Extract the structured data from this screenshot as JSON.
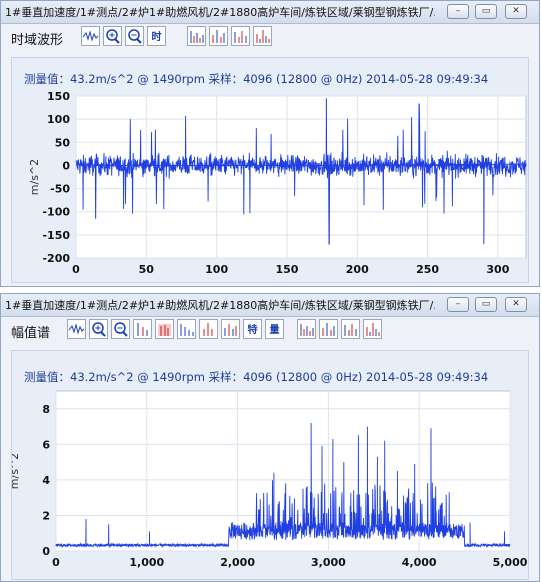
{
  "win1": {
    "title": "1#垂直加速度/1#测点/2#炉1#助燃风机/2#1880高炉车间/炼铁区域/莱钢型钢炼铁厂/…",
    "mode_label": "时域波形",
    "buttons": [
      "wave",
      "zoom-in",
      "zoom-out",
      "时",
      "spectrum",
      "peaks",
      "peaks-alt",
      "spectrum-alt"
    ],
    "time_btn_label": "时",
    "info": "测量值：43.2m/s^2 @ 1490rpm  采样：4096 (12800 @ 0Hz)  2014-05-28 09:49:34"
  },
  "win2": {
    "title": "1#垂直加速度/1#测点/2#炉1#助燃风机/2#1880高炉车间/炼铁区域/莱钢型钢炼铁厂/…",
    "mode_label": "幅值谱",
    "buttons": [
      "wave",
      "zoom-in",
      "zoom-out",
      "cursor",
      "band",
      "harmonic",
      "sideband",
      "marker",
      "特",
      "量",
      "spectrum",
      "peaks",
      "peaks-alt",
      "spectrum-alt"
    ],
    "feature_btn_label": "特",
    "amount_btn_label": "量",
    "info": "测量值：43.2m/s^2 @ 1490rpm  采样：4096 (12800 @ 0Hz)  2014-05-28 09:49:34"
  },
  "window_buttons": {
    "min": "–",
    "restore": "▭",
    "close": "✕"
  },
  "chart_data": [
    {
      "type": "line",
      "title": "",
      "xlabel": "",
      "ylabel": "m/s^2",
      "xlim": [
        0,
        320
      ],
      "ylim": [
        -200,
        150
      ],
      "xticks": [
        "0",
        "50",
        "100",
        "150",
        "200",
        "250",
        "300"
      ],
      "yticks": [
        "150",
        "100",
        "50",
        "0",
        "-50",
        "-100",
        "-150",
        "-200"
      ],
      "series": [
        {
          "values": [],
          "description_note": null
        }
      ],
      "grid": true,
      "line_color": "#1f3fe0",
      "notable_peaks": [
        {
          "x": 180,
          "y": -170
        },
        {
          "x": 178,
          "y": 145
        },
        {
          "x": 14,
          "y": -115
        },
        {
          "x": 290,
          "y": -170
        },
        {
          "x": 244,
          "y": 133
        }
      ],
      "typical_amplitude": [
        -40,
        40
      ]
    },
    {
      "type": "line",
      "title": "",
      "xlabel": "",
      "ylabel": "m/s^2",
      "xlim": [
        0,
        5000
      ],
      "ylim": [
        0,
        9
      ],
      "xticks": [
        "0",
        "1,000",
        "2,000",
        "3,000",
        "4,000",
        "5,000"
      ],
      "yticks": [
        "8",
        "6",
        "4",
        "2",
        "0"
      ],
      "grid": true,
      "line_color": "#1f3fe0",
      "peaks": [
        {
          "x": 330,
          "y": 1.8
        },
        {
          "x": 580,
          "y": 1.5
        },
        {
          "x": 1030,
          "y": 1.1
        },
        {
          "x": 1980,
          "y": 1.3
        },
        {
          "x": 2250,
          "y": 2.9
        },
        {
          "x": 2400,
          "y": 4.4
        },
        {
          "x": 2530,
          "y": 3.8
        },
        {
          "x": 2720,
          "y": 3.5
        },
        {
          "x": 2810,
          "y": 7.2
        },
        {
          "x": 2930,
          "y": 5.9
        },
        {
          "x": 3050,
          "y": 6.3
        },
        {
          "x": 3170,
          "y": 5.0
        },
        {
          "x": 3330,
          "y": 6.5
        },
        {
          "x": 3430,
          "y": 7.0
        },
        {
          "x": 3540,
          "y": 5.3
        },
        {
          "x": 3620,
          "y": 6.2
        },
        {
          "x": 3760,
          "y": 4.5
        },
        {
          "x": 3950,
          "y": 4.9
        },
        {
          "x": 4130,
          "y": 6.9
        },
        {
          "x": 4330,
          "y": 3.3
        },
        {
          "x": 4560,
          "y": 1.6
        },
        {
          "x": 4940,
          "y": 1.1
        }
      ]
    }
  ]
}
